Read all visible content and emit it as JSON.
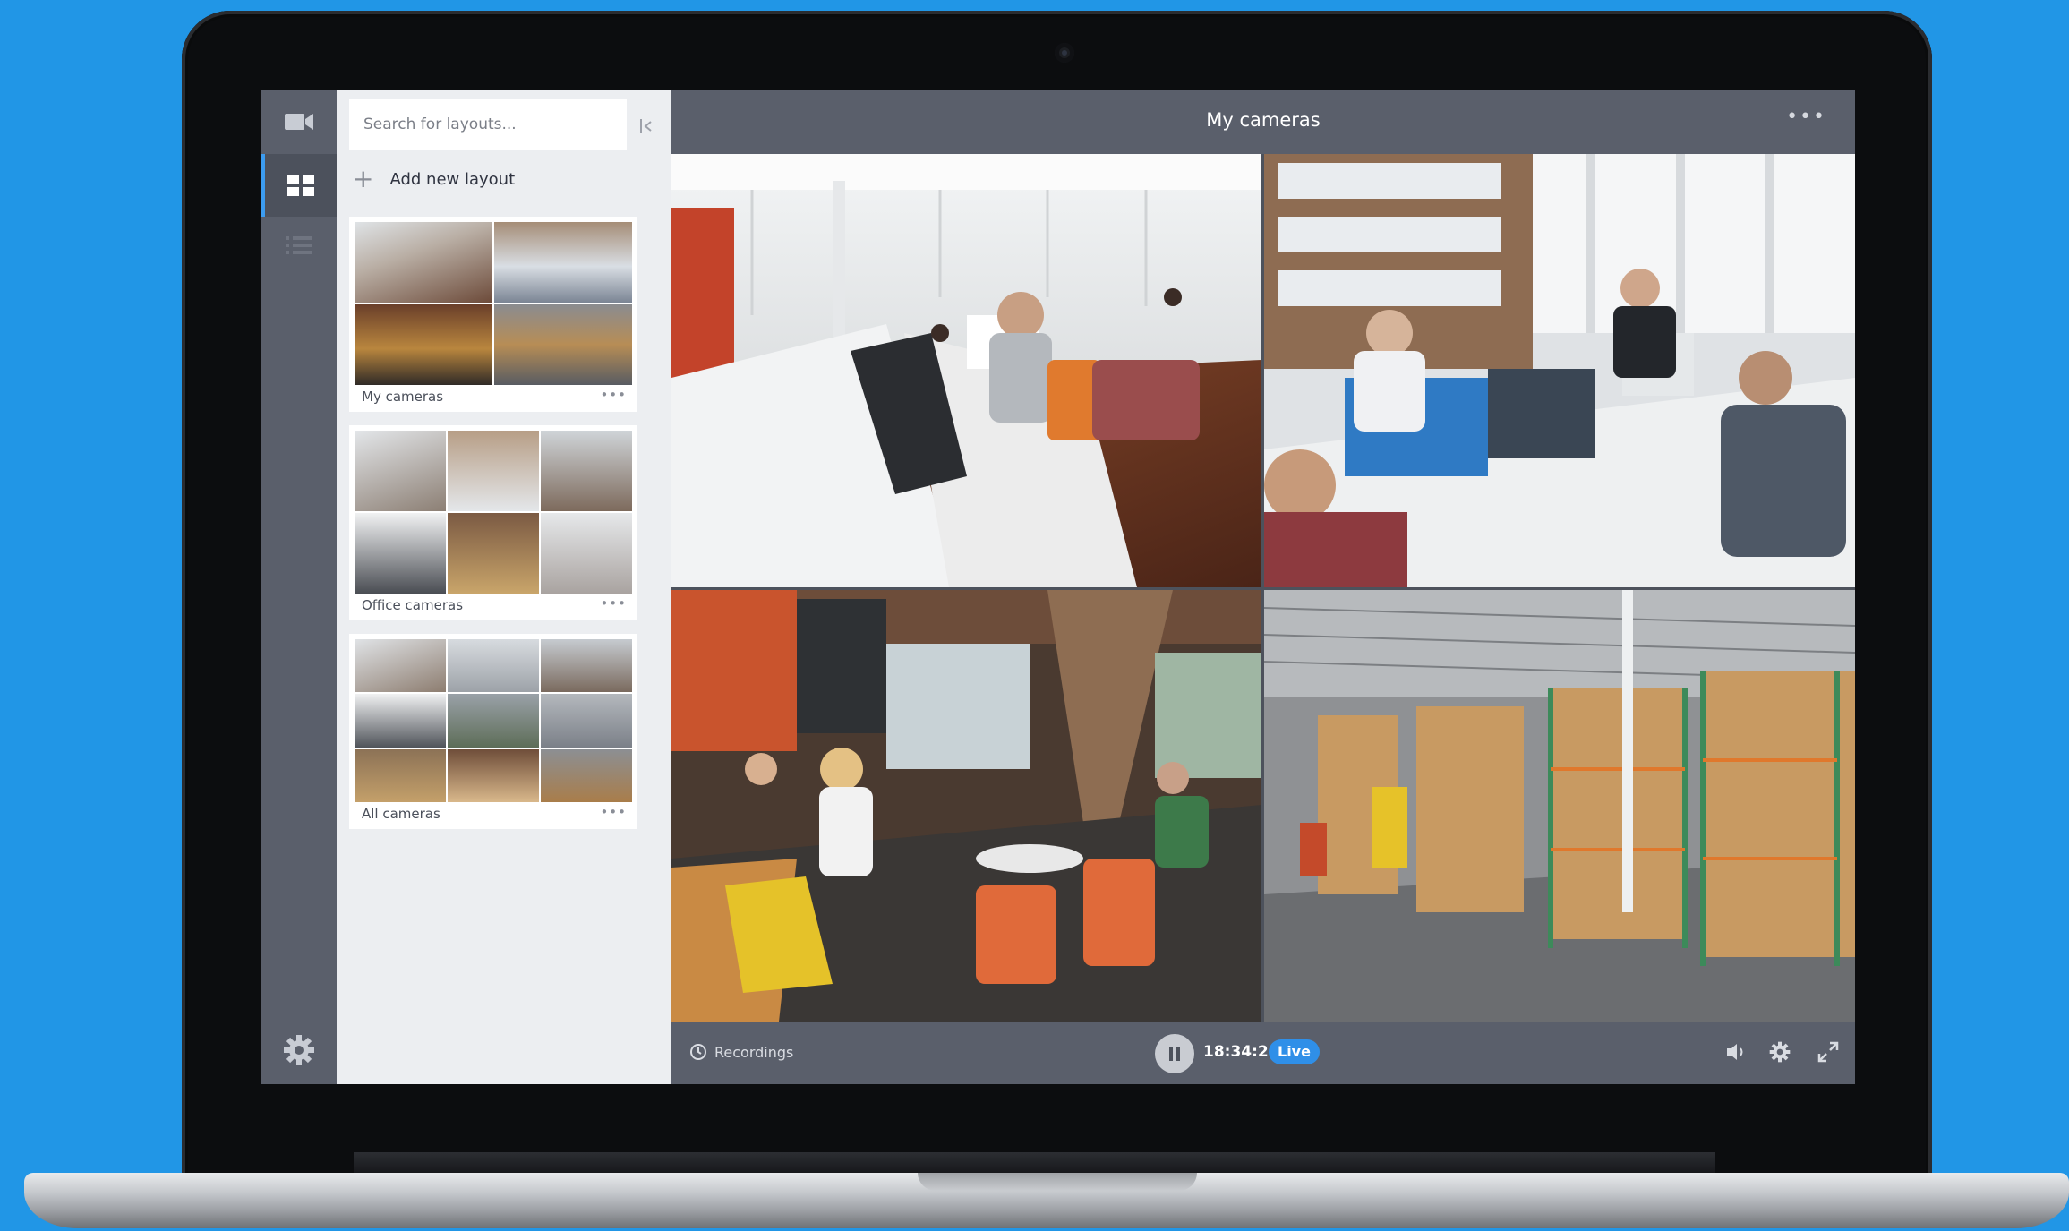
{
  "colors": {
    "background": "#2196e6",
    "accent": "#2f8fe8",
    "panel": "#eceef1",
    "rail": "#5a5f6b"
  },
  "rail": {
    "items": [
      {
        "icon": "video-camera-icon"
      },
      {
        "icon": "grid-icon",
        "active": true
      },
      {
        "icon": "list-icon"
      }
    ],
    "settings_icon": "gear-icon"
  },
  "panel": {
    "search_placeholder": "Search for layouts...",
    "add_layout_label": "Add new layout",
    "layouts": [
      {
        "name": "My cameras",
        "more": "•••"
      },
      {
        "name": "Office cameras",
        "more": "•••"
      },
      {
        "name": "All cameras",
        "more": "•••"
      }
    ]
  },
  "main": {
    "title": "My cameras",
    "more": "•••"
  },
  "controls": {
    "recordings_label": "Recordings",
    "time": "18:34:22",
    "live_label": "Live",
    "icons": [
      "volume-icon",
      "gear-icon",
      "fullscreen-icon"
    ]
  }
}
